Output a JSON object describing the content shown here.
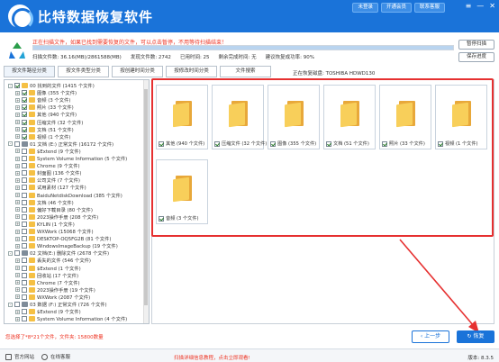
{
  "app": {
    "title": "比特数据恢复软件",
    "top_buttons": [
      "未登录",
      "开通会员",
      "联系客服"
    ]
  },
  "scan": {
    "status": "正在扫描文件，如果已找到需要恢复的文件，可以点击暂停，不用等待扫描结束！",
    "progress_percent": 100,
    "scanned_size": "扫描文件数: 36.16(MB)/2861588(MB)",
    "found_files": "发现文件数: 2742",
    "elapsed": "已用时间: 25",
    "remaining": "剩余完成时间: 无",
    "suggestion": "建议恢复成功率: 90%",
    "pause_label": "暂停扫描",
    "save_label": "保存进度"
  },
  "tabs": [
    "按文件路径分类",
    "按文件类型分类",
    "按创建时间分类",
    "按修改时间分类",
    "文件搜索"
  ],
  "location": "正在恢复磁盘: TOSHIBA HDWD130",
  "tree": [
    {
      "level": 0,
      "exp": "-",
      "checked": true,
      "icon": "folder",
      "label": "00 找到的文件 (1415 个文件)"
    },
    {
      "level": 1,
      "exp": "+",
      "checked": true,
      "icon": "folder",
      "label": "图像   (355 个文件)"
    },
    {
      "level": 1,
      "exp": "+",
      "checked": true,
      "icon": "folder",
      "label": "音频   (3 个文件)"
    },
    {
      "level": 1,
      "exp": "+",
      "checked": true,
      "icon": "folder",
      "label": "照片   (33 个文件)"
    },
    {
      "level": 1,
      "exp": "+",
      "checked": true,
      "icon": "folder",
      "label": "其他   (940 个文件)"
    },
    {
      "level": 1,
      "exp": "+",
      "checked": true,
      "icon": "folder",
      "label": "压缩文件   (32 个文件)"
    },
    {
      "level": 1,
      "exp": "+",
      "checked": true,
      "icon": "folder",
      "label": "文档   (51 个文件)"
    },
    {
      "level": 1,
      "exp": "+",
      "checked": true,
      "icon": "folder",
      "label": "视频   (1 个文件)"
    },
    {
      "level": 0,
      "exp": "-",
      "checked": false,
      "icon": "drive",
      "label": "01 文档 (E:) 正常文件  (16172 个文件)"
    },
    {
      "level": 1,
      "exp": "+",
      "checked": false,
      "icon": "folder",
      "label": "$Extend   (9 个文件)"
    },
    {
      "level": 1,
      "exp": "+",
      "checked": false,
      "icon": "folder",
      "label": "System Volume Information   (5 个文件)"
    },
    {
      "level": 1,
      "exp": "+",
      "checked": false,
      "icon": "folder",
      "label": "Chrome   (9 个文件)"
    },
    {
      "level": 1,
      "exp": "+",
      "checked": false,
      "icon": "folder",
      "label": "封面图   (136 个文件)"
    },
    {
      "level": 1,
      "exp": "+",
      "checked": false,
      "icon": "folder",
      "label": "公司文件   (7 个文件)"
    },
    {
      "level": 1,
      "exp": "+",
      "checked": false,
      "icon": "folder",
      "label": "试用素材   (127 个文件)"
    },
    {
      "level": 1,
      "exp": "+",
      "checked": false,
      "icon": "folder",
      "label": "BaiduNetdiskDownload   (385 个文件)"
    },
    {
      "level": 1,
      "exp": "+",
      "checked": false,
      "icon": "folder",
      "label": "文档   (46 个文件)"
    },
    {
      "level": 1,
      "exp": "+",
      "checked": false,
      "icon": "folder",
      "label": "偏好下载目录   (80 个文件)"
    },
    {
      "level": 1,
      "exp": "+",
      "checked": false,
      "icon": "folder",
      "label": "2023操作手册   (208 个文件)"
    },
    {
      "level": 1,
      "exp": "+",
      "checked": false,
      "icon": "folder",
      "label": "KYLIN   (1 个文件)"
    },
    {
      "level": 1,
      "exp": "+",
      "checked": false,
      "icon": "folder",
      "label": "WXWork   (15068 个文件)"
    },
    {
      "level": 1,
      "exp": "+",
      "checked": false,
      "icon": "folder",
      "label": "DESKTOP-OQ5FG2B   (81 个文件)"
    },
    {
      "level": 1,
      "exp": "+",
      "checked": false,
      "icon": "folder",
      "label": "WindowsImageBackup   (19 个文件)"
    },
    {
      "level": 0,
      "exp": "-",
      "checked": false,
      "icon": "drive",
      "label": "02 文档(E:) 删除文件  (2678 个文件)"
    },
    {
      "level": 1,
      "exp": "+",
      "checked": false,
      "icon": "folder",
      "label": "丢失的文件   (546 个文件)"
    },
    {
      "level": 1,
      "exp": "+",
      "checked": false,
      "icon": "folder",
      "label": "$Extend   (1 个文件)"
    },
    {
      "level": 1,
      "exp": "+",
      "checked": false,
      "icon": "folder",
      "label": "回收站   (17 个文件)"
    },
    {
      "level": 1,
      "exp": "+",
      "checked": false,
      "icon": "folder",
      "label": "Chrome   (7 个文件)"
    },
    {
      "level": 1,
      "exp": "+",
      "checked": false,
      "icon": "folder",
      "label": "2023操作手册   (19 个文件)"
    },
    {
      "level": 1,
      "exp": "+",
      "checked": false,
      "icon": "folder",
      "label": "WXWork   (2087 个文件)"
    },
    {
      "level": 0,
      "exp": "-",
      "checked": false,
      "icon": "drive",
      "label": "03 数据 (F:) 正常文件  (726 个文件)"
    },
    {
      "level": 1,
      "exp": "+",
      "checked": false,
      "icon": "folder",
      "label": "$Extend   (9 个文件)"
    },
    {
      "level": 1,
      "exp": "+",
      "checked": false,
      "icon": "folder",
      "label": "System Volume Information   (4 个文件)"
    }
  ],
  "cards": [
    {
      "label": "其他 (940 个文件)"
    },
    {
      "label": "压缩文件 (32 个文件)"
    },
    {
      "label": "图像 (355 个文件)"
    },
    {
      "label": "文档 (51 个文件)"
    },
    {
      "label": "照片 (33 个文件)"
    },
    {
      "label": "视频 (1 个文件)"
    },
    {
      "label": "音频 (3 个文件)"
    }
  ],
  "bottom": {
    "status": "您选择了*8*21个文件，文件夹: 15800数量",
    "prev_label": "上一步",
    "recover_label": "恢复"
  },
  "footer": {
    "website": "官方网站",
    "consult": "在线客服",
    "center_notice": "扫描详细信息教程，点击立即观看!",
    "version": "版本: 8.3.5"
  },
  "colors": {
    "brand": "#1a73d9",
    "alert": "#e63030"
  }
}
